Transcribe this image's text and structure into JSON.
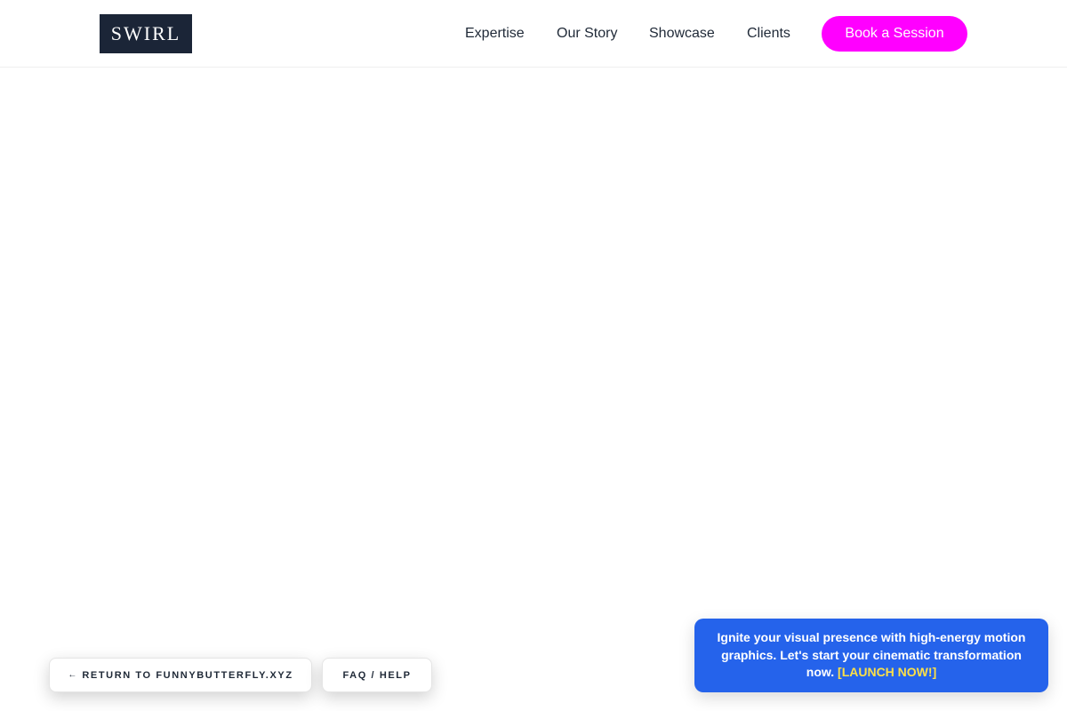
{
  "header": {
    "logo": "SWIRL",
    "nav": [
      "Expertise",
      "Our Story",
      "Showcase",
      "Clients"
    ],
    "cta_label": "Book a Session"
  },
  "footer": {
    "return_arrow": "←",
    "return_label": "RETURN TO FUNNYBUTTERFLY.XYZ",
    "faq_label": "FAQ / HELP"
  },
  "promo": {
    "text": "Ignite your visual presence with high-energy motion graphics. Let's start your cinematic transformation now.",
    "link_label": "[LAUNCH NOW!]"
  },
  "colors": {
    "logo_bg": "#1b2537",
    "cta_bg": "#ff00ff",
    "promo_bg": "#2563eb",
    "promo_link": "#fde047"
  }
}
